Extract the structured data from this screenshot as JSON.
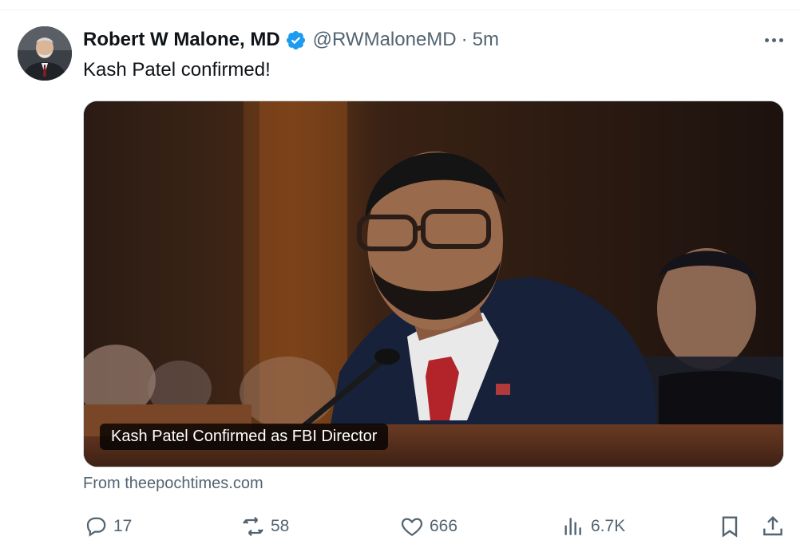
{
  "tweet": {
    "author": {
      "display_name": "Robert W Malone, MD",
      "handle": "@RWMaloneMD",
      "separator": "·",
      "time": "5m",
      "avatar_icon": "avatar-photo"
    },
    "text": "Kash Patel confirmed!",
    "media": {
      "caption": "Kash Patel Confirmed as FBI Director",
      "image": "photo-man-speaking-at-hearing"
    },
    "source": "From theepochtimes.com",
    "actions": {
      "replies": "17",
      "reposts": "58",
      "likes": "666",
      "views": "6.7K"
    }
  },
  "colors": {
    "text_primary": "#0f1419",
    "text_secondary": "#536471",
    "verified_blue": "#1d9bf0",
    "border": "#cfd9de"
  }
}
